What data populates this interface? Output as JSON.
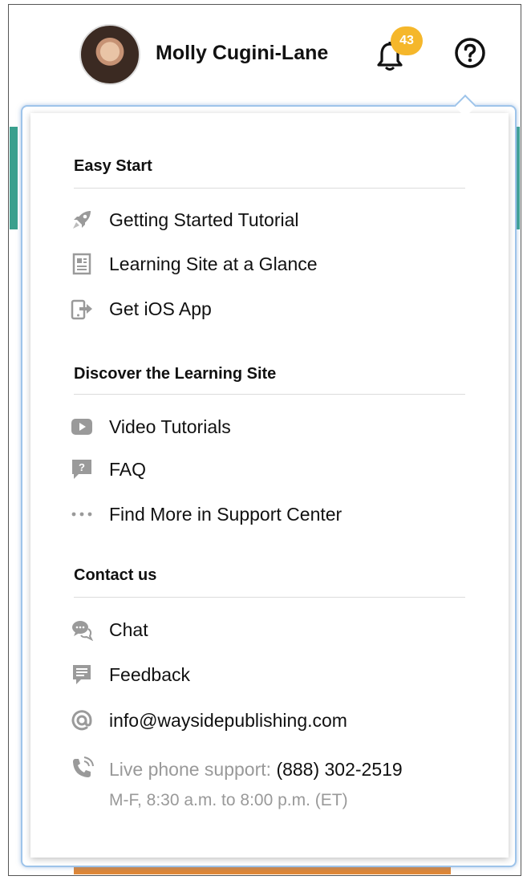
{
  "header": {
    "username": "Molly Cugini-Lane",
    "notification_count": "43"
  },
  "help_menu": {
    "sections": [
      {
        "title": "Easy Start",
        "items": [
          {
            "label": "Getting Started Tutorial",
            "icon": "rocket-icon"
          },
          {
            "label": "Learning Site at a Glance",
            "icon": "document-icon"
          },
          {
            "label": "Get iOS App",
            "icon": "mobile-app-icon"
          }
        ]
      },
      {
        "title": "Discover the Learning Site",
        "items": [
          {
            "label": "Video Tutorials",
            "icon": "video-play-icon"
          },
          {
            "label": "FAQ",
            "icon": "faq-icon"
          },
          {
            "label": "Find More in Support Center",
            "icon": "more-dots-icon"
          }
        ]
      },
      {
        "title": "Contact us",
        "items": [
          {
            "label": "Chat",
            "icon": "chat-icon"
          },
          {
            "label": "Feedback",
            "icon": "feedback-icon"
          },
          {
            "label": "info@waysidepublishing.com",
            "icon": "at-sign-icon"
          }
        ]
      }
    ],
    "phone": {
      "label": "Live phone support: ",
      "number": "(888) 302-2519",
      "hours": "M-F, 8:30 a.m. to 8:00 p.m. (ET)"
    }
  },
  "colors": {
    "badge": "#f5b72b",
    "accent_teal": "#3aa08e",
    "dropdown_border": "#9ec4ea",
    "icon_gray": "#9a9a9a"
  }
}
